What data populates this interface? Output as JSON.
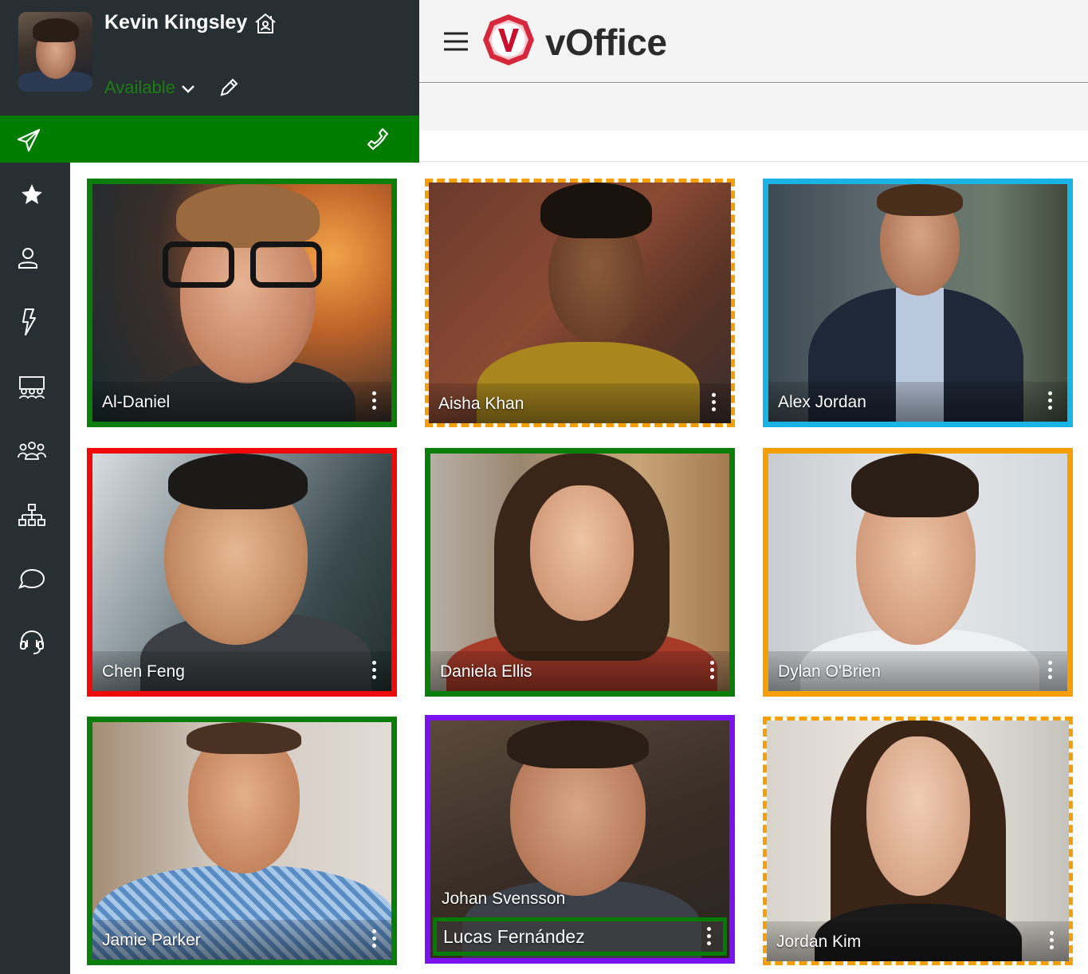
{
  "user": {
    "name": "Kevin Kingsley",
    "status": "Available",
    "status_color": "#1e7d12"
  },
  "app": {
    "title": "vOffice",
    "brand_color": "#d6283c",
    "action_bar_color": "#007c00"
  },
  "nav": {
    "items": [
      {
        "icon": "star-icon"
      },
      {
        "icon": "person-icon"
      },
      {
        "icon": "lightning-icon"
      },
      {
        "icon": "meeting-room-icon"
      },
      {
        "icon": "group-icon"
      },
      {
        "icon": "org-chart-icon"
      },
      {
        "icon": "chat-bubble-icon"
      },
      {
        "icon": "headset-icon"
      }
    ]
  },
  "contacts": [
    {
      "name": "Al-Daniel",
      "border_color": "#0b7d0b",
      "border_style": "solid"
    },
    {
      "name": "Aisha Khan",
      "border_color": "#f5a000",
      "border_style": "dashed"
    },
    {
      "name": "Alex Jordan",
      "border_color": "#1ab3e6",
      "border_style": "solid"
    },
    {
      "name": "Chen Feng",
      "border_color": "#ee0a0a",
      "border_style": "solid"
    },
    {
      "name": "Daniela Ellis",
      "border_color": "#0b7d0b",
      "border_style": "solid"
    },
    {
      "name": "Dylan O'Brien",
      "border_color": "#f5a000",
      "border_style": "solid"
    },
    {
      "name": "Jamie Parker",
      "border_color": "#0b7d0b",
      "border_style": "solid"
    },
    {
      "name": "Johan Svensson",
      "border_color": "#7a12f0",
      "border_style": "solid",
      "shared_with": {
        "name": "Lucas Fernández",
        "border_color": "#007c00"
      }
    },
    {
      "name": "Jordan Kim",
      "border_color": "#f5a000",
      "border_style": "dashed"
    }
  ]
}
